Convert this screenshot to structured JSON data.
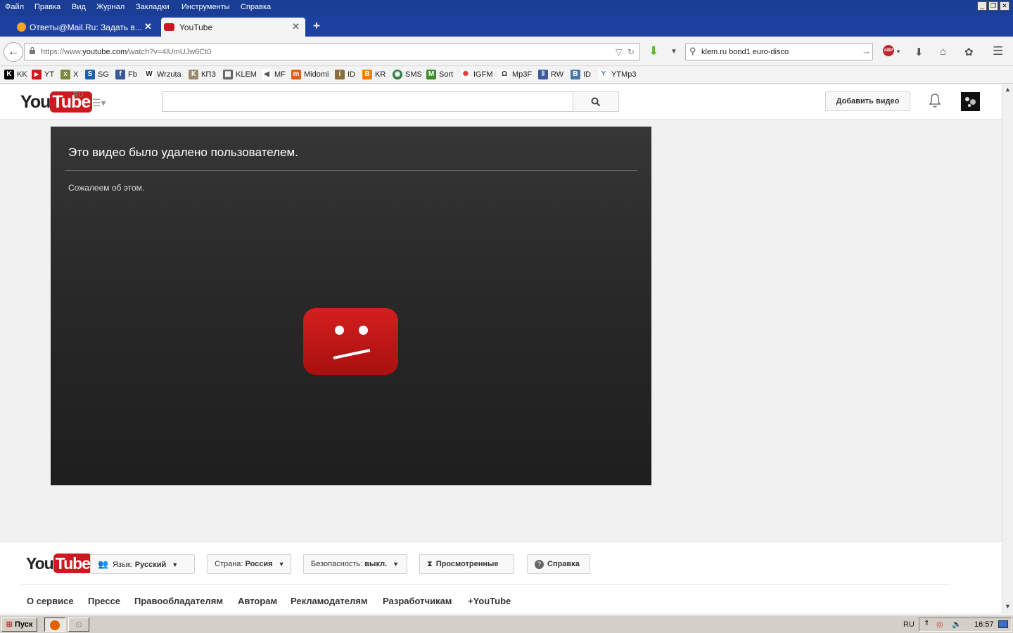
{
  "menubar": {
    "items": [
      "Файл",
      "Правка",
      "Вид",
      "Журнал",
      "Закладки",
      "Инструменты",
      "Справка"
    ]
  },
  "tabs": [
    {
      "title": "Ответы@Mail.Ru: Задать в...",
      "active": false
    },
    {
      "title": "YouTube",
      "active": true
    }
  ],
  "navbar": {
    "url_prefix": "https://www.",
    "url_host": "youtube.com",
    "url_path": "/watch?v=4lUmUJw6Ct0",
    "search_value": "klem.ru bond1 euro-disco"
  },
  "bookmarks": [
    {
      "label": "KK",
      "icon": "k-icon",
      "color": "#000000",
      "glyph": "K"
    },
    {
      "label": "YT",
      "icon": "youtube-icon",
      "color": "#cc181e",
      "glyph": "▶"
    },
    {
      "label": "X",
      "icon": "x-site-icon",
      "color": "#7a8a3a",
      "glyph": "x"
    },
    {
      "label": "SG",
      "icon": "sg-icon",
      "color": "#1d5fb0",
      "glyph": "S"
    },
    {
      "label": "Fb",
      "icon": "facebook-icon",
      "color": "#3b5998",
      "glyph": "f"
    },
    {
      "label": "Wrzuta",
      "icon": "wrzuta-icon",
      "color": "#222222",
      "glyph": "W"
    },
    {
      "label": "КПЗ",
      "icon": "kpz-icon",
      "color": "#9b8a6b",
      "glyph": "К"
    },
    {
      "label": "KLEM",
      "icon": "klem-icon",
      "color": "#666666",
      "glyph": "▦"
    },
    {
      "label": "MF",
      "icon": "speaker-icon",
      "color": "#555555",
      "glyph": "◀"
    },
    {
      "label": "Midomi",
      "icon": "midomi-icon",
      "color": "#e25d10",
      "glyph": "m"
    },
    {
      "label": "ID",
      "icon": "id-icon",
      "color": "#8a6b3a",
      "glyph": "i"
    },
    {
      "label": "KR",
      "icon": "blogger-icon",
      "color": "#f57d00",
      "glyph": "B"
    },
    {
      "label": "SMS",
      "icon": "globe-icon",
      "color": "#2f7a3c",
      "glyph": "◉"
    },
    {
      "label": "Sort",
      "icon": "mp3-sort-icon",
      "color": "#3b8f2a",
      "glyph": "M"
    },
    {
      "label": "IGFM",
      "icon": "starburst-icon",
      "color": "#e23a3a",
      "glyph": "✺"
    },
    {
      "label": "Mp3F",
      "icon": "headphones-icon",
      "color": "#333333",
      "glyph": "Ω"
    },
    {
      "label": "RW",
      "icon": "rw-icon",
      "color": "#3a5a9c",
      "glyph": "‖"
    },
    {
      "label": "ID",
      "icon": "vk-icon",
      "color": "#4a76a8",
      "glyph": "В"
    },
    {
      "label": "YTMp3",
      "icon": "ytmp3-icon",
      "color": "#5a7ab5",
      "glyph": "Y"
    }
  ],
  "masthead": {
    "logo_you": "You",
    "logo_tube": "Tube",
    "logo_region": "RU",
    "search_placeholder": "",
    "upload_label": "Добавить видео"
  },
  "player_error": {
    "title": "Это видео было удалено пользователем.",
    "subtitle": "Сожалеем об этом."
  },
  "footer": {
    "logo_you": "You",
    "logo_tube": "Tube",
    "language_prefix": "Язык:",
    "language_value": "Русский",
    "country_prefix": "Страна:",
    "country_value": "Россия",
    "safety_prefix": "Безопасность:",
    "safety_value": "выкл.",
    "history_label": "Просмотренные",
    "help_label": "Справка",
    "links": [
      "О сервисе",
      "Прессе",
      "Правообладателям",
      "Авторам",
      "Рекламодателям",
      "Разработчикам",
      "+YouTube"
    ]
  },
  "taskbar": {
    "start_label": "Пуск",
    "language": "RU",
    "clock": "16:57"
  },
  "colors": {
    "titlebar": "#1a3d96",
    "youtube_red": "#cc181e",
    "player_bg": "#2a2a2a"
  }
}
